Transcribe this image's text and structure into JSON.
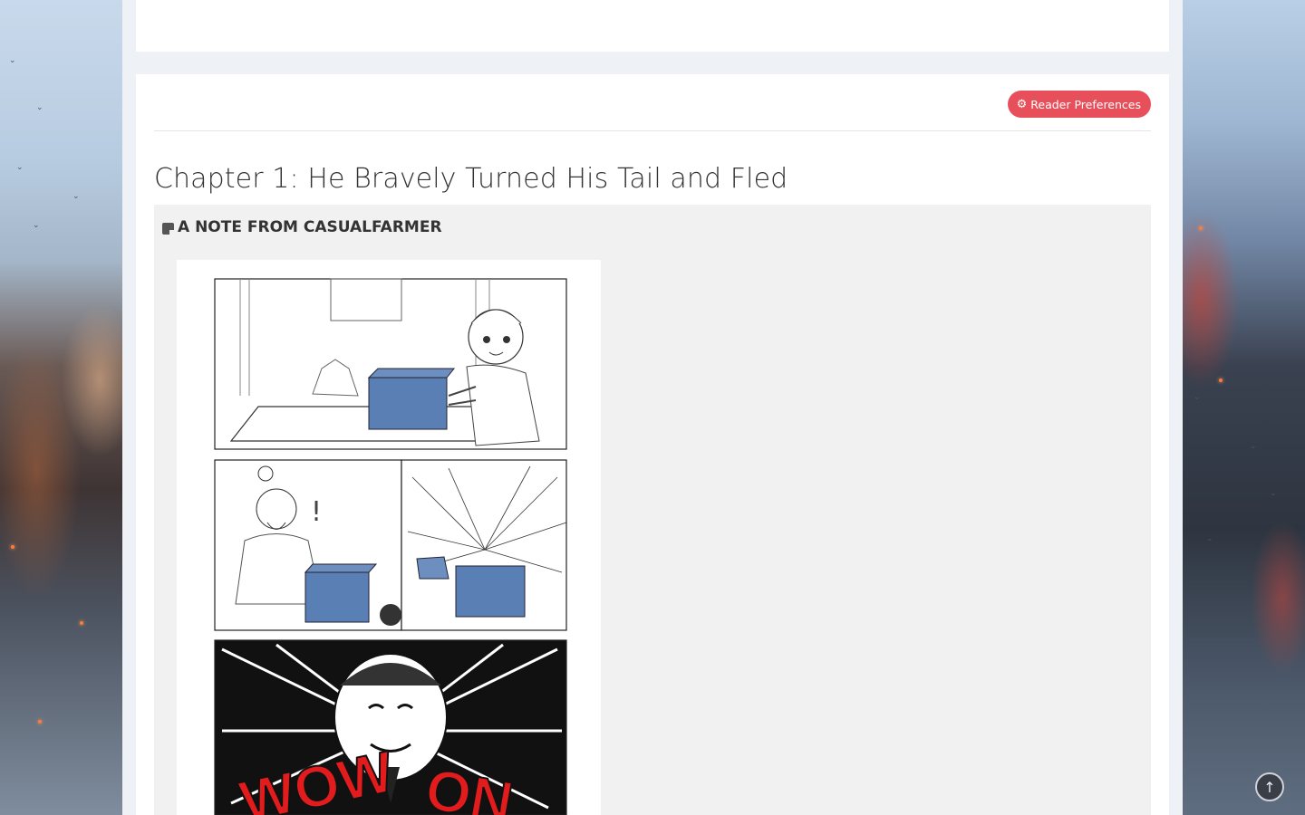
{
  "reader": {
    "preferences_label": "Reader Preferences",
    "preferences_icon": "gear-icon"
  },
  "chapter": {
    "title": "Chapter 1: He Bravely Turned His Tail and Fled"
  },
  "author_note": {
    "header": "A NOTE FROM CASUALFARMER",
    "icon": "note-icon",
    "image_text": [
      "!",
      "WOW",
      "ON"
    ]
  },
  "scroll_top": {
    "icon": "arrow-up-circle-icon"
  },
  "colors": {
    "accent": "#e7505a",
    "panel_bg": "#ffffff",
    "note_bg": "#f1f1f1",
    "page_bg": "#eef1f5",
    "comic_blue": "#5a7fb5",
    "comic_red": "#e21c1c"
  }
}
